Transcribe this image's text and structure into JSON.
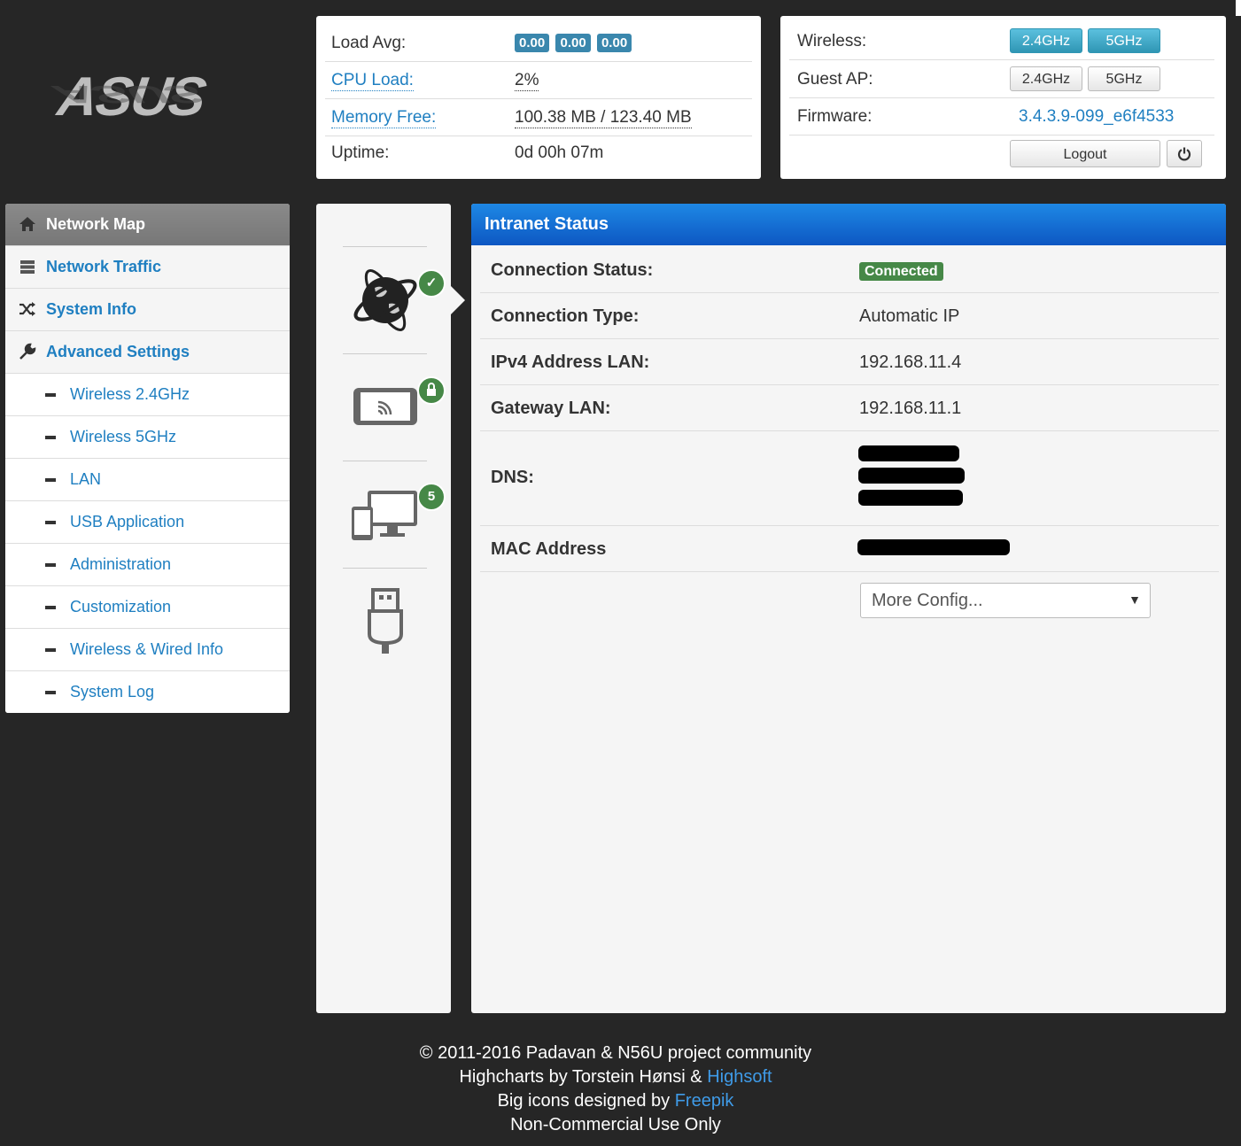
{
  "logo": {
    "text": "ASUS"
  },
  "status": {
    "load_avg_label": "Load Avg:",
    "load_avg": [
      "0.00",
      "0.00",
      "0.00"
    ],
    "cpu_label": "CPU Load:",
    "cpu_value": "2%",
    "mem_label": "Memory Free:",
    "mem_value": "100.38 MB / 123.40 MB",
    "uptime_label": "Uptime:",
    "uptime_value": "0d 00h 07m"
  },
  "info": {
    "wireless_label": "Wireless:",
    "wireless_24": "2.4GHz",
    "wireless_5": "5GHz",
    "guest_label": "Guest AP:",
    "guest_24": "2.4GHz",
    "guest_5": "5GHz",
    "firmware_label": "Firmware:",
    "firmware_value": "3.4.3.9-099_e6f4533",
    "logout_label": "Logout"
  },
  "menu": {
    "network_map": "Network Map",
    "network_traffic": "Network Traffic",
    "system_info": "System Info",
    "advanced_settings": "Advanced Settings",
    "sub": {
      "wireless24": "Wireless 2.4GHz",
      "wireless5": "Wireless 5GHz",
      "lan": "LAN",
      "usb": "USB Application",
      "admin": "Administration",
      "custom": "Customization",
      "wired_info": "Wireless & Wired Info",
      "syslog": "System Log"
    }
  },
  "icons": {
    "clients_count": "5"
  },
  "intranet": {
    "title": "Intranet Status",
    "conn_status_label": "Connection Status:",
    "conn_status_value": "Connected",
    "conn_type_label": "Connection Type:",
    "conn_type_value": "Automatic IP",
    "ipv4_label": "IPv4 Address LAN:",
    "ipv4_value": "192.168.11.4",
    "gateway_label": "Gateway LAN:",
    "gateway_value": "192.168.11.1",
    "dns_label": "DNS:",
    "mac_label": "MAC Address",
    "more_config": "More Config..."
  },
  "footer": {
    "line1": "© 2011-2016 Padavan & N56U project community",
    "line2_pre": "Highcharts by Torstein Hønsi & ",
    "line2_link": "Highsoft",
    "line3_pre": "Big icons designed by ",
    "line3_link": "Freepik",
    "line4": "Non-Commercial Use Only"
  }
}
